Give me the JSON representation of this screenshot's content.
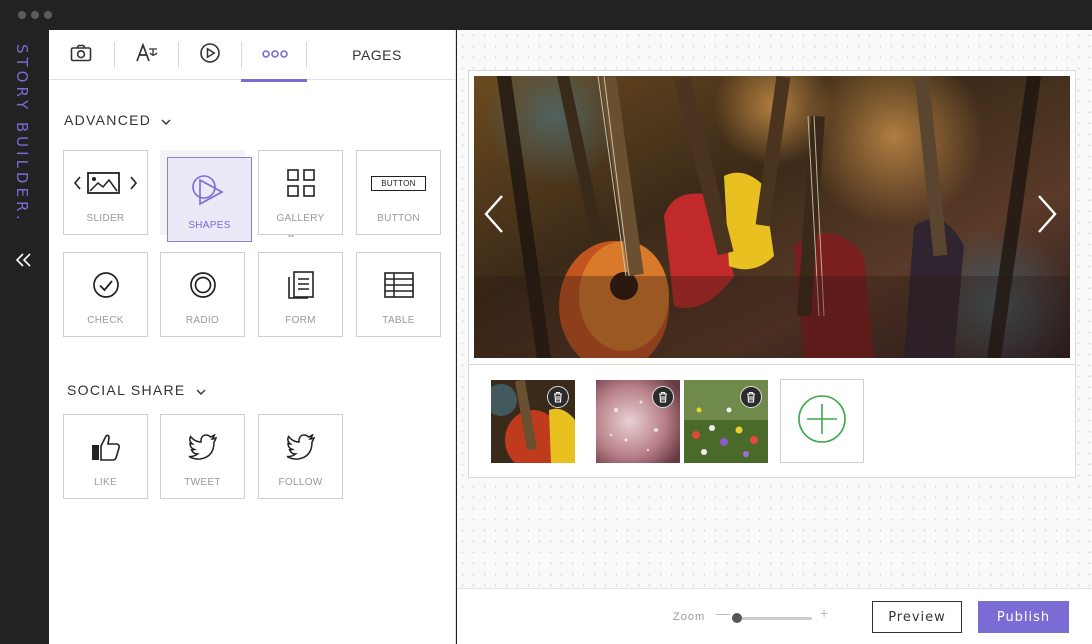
{
  "app": {
    "brand": "STORY BUILDER."
  },
  "toolbar": {
    "tabs": [
      {
        "icon": "camera-icon"
      },
      {
        "icon": "text-icon"
      },
      {
        "icon": "play-icon"
      },
      {
        "icon": "more-icon",
        "active": true
      }
    ],
    "pages_label": "PAGES"
  },
  "advanced": {
    "title": "ADVANCED",
    "items": [
      {
        "label": "SLIDER",
        "icon": "slider-icon"
      },
      {
        "label": "SHAPES",
        "icon": "shapes-icon",
        "selected": true
      },
      {
        "label": "GALLERY",
        "icon": "gallery-icon"
      },
      {
        "label": "BUTTON",
        "icon": "button-icon",
        "icon_text": "BUTTON"
      },
      {
        "label": "CHECK",
        "icon": "check-icon"
      },
      {
        "label": "RADIO",
        "icon": "radio-icon"
      },
      {
        "label": "FORM",
        "icon": "form-icon"
      },
      {
        "label": "TABLE",
        "icon": "table-icon"
      }
    ]
  },
  "social": {
    "title": "SOCIAL SHARE",
    "items": [
      {
        "label": "LIKE",
        "icon": "thumbs-up-icon"
      },
      {
        "label": "TWEET",
        "icon": "twitter-icon"
      },
      {
        "label": "FOLLOW",
        "icon": "twitter-icon"
      }
    ]
  },
  "canvas": {
    "hero_image": "guitars-photo",
    "thumbnails": [
      {
        "image": "guitars-photo"
      },
      {
        "image": "pink-abstract-photo"
      },
      {
        "image": "wildflowers-photo"
      }
    ]
  },
  "footer": {
    "zoom_label": "Zoom",
    "zoom_minus": "—",
    "zoom_plus": "+",
    "zoom_level": 0.05,
    "preview_label": "Preview",
    "publish_label": "Publish"
  },
  "colors": {
    "accent": "#7b6bd4",
    "add": "#3aaa4c",
    "dark": "#222222"
  }
}
